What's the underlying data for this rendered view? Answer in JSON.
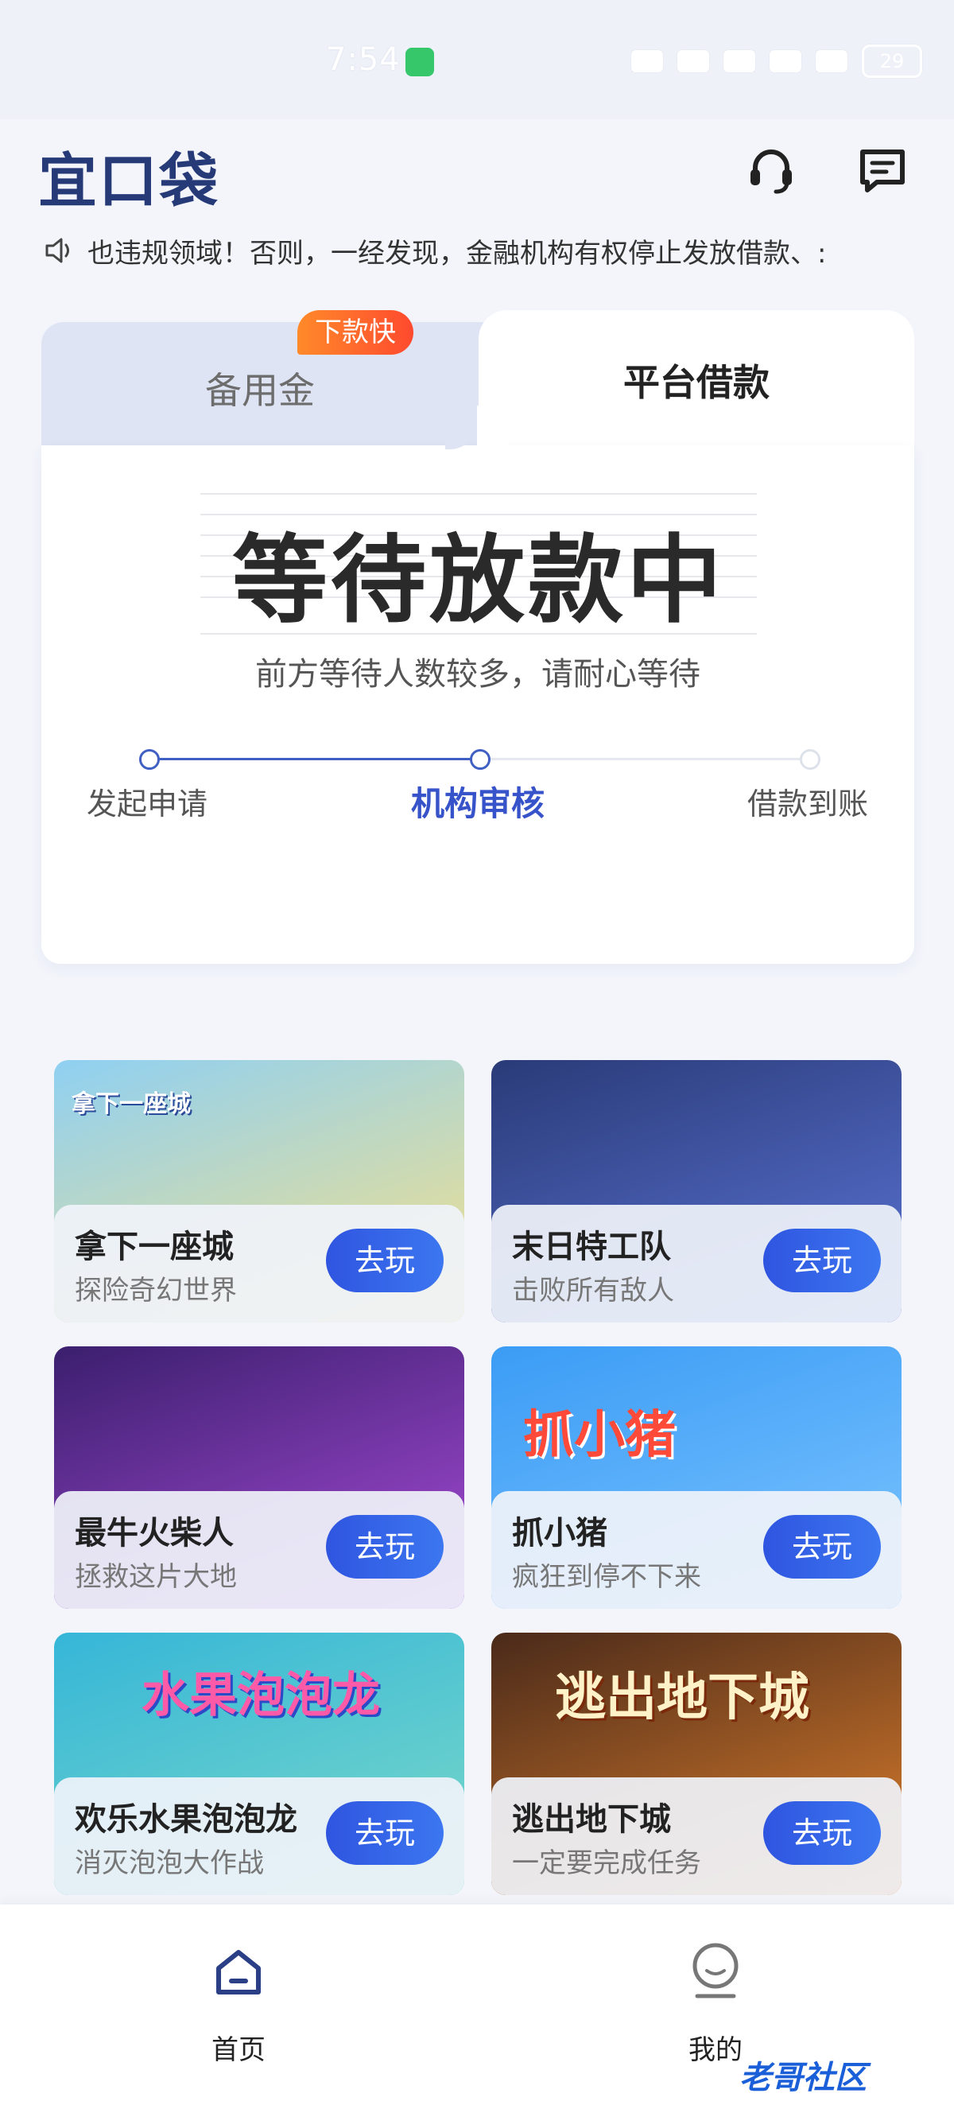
{
  "status_bar": {
    "time": "7:54",
    "battery": "29"
  },
  "header": {
    "logo": "宜口袋",
    "support_icon": "headset-icon",
    "message_icon": "message-icon"
  },
  "notice": {
    "icon": "speaker-icon",
    "text": "也违规领域！否则，一经发现，金融机构有权停止发放借款、:"
  },
  "loan_card": {
    "tabs": [
      {
        "label": "备用金",
        "badge": "下款快"
      },
      {
        "label": "平台借款"
      }
    ],
    "status_title": "等待放款中",
    "status_subtitle": "前方等待人数较多，请耐心等待",
    "steps": [
      {
        "label": "发起申请",
        "state": "done"
      },
      {
        "label": "机构审核",
        "state": "current"
      },
      {
        "label": "借款到账",
        "state": "todo"
      }
    ]
  },
  "games": [
    {
      "title": "拿下一座城",
      "subtitle": "探险奇幻世界",
      "button": "去玩",
      "art_text": "拿下一座城",
      "colors": [
        "#8fd0f2",
        "#f5e08a"
      ]
    },
    {
      "title": "末日特工队",
      "subtitle": "击败所有敌人",
      "button": "去玩",
      "art_text": "",
      "colors": [
        "#2a3b78",
        "#5b74d6"
      ]
    },
    {
      "title": "最牛火柴人",
      "subtitle": "拯救这片大地",
      "button": "去玩",
      "art_text": "",
      "colors": [
        "#3b1f6e",
        "#a84bd8"
      ]
    },
    {
      "title": "抓小猪",
      "subtitle": "疯狂到停不下来",
      "button": "去玩",
      "art_text": "抓小猪",
      "colors": [
        "#3b9cf5",
        "#7cc4ff"
      ]
    },
    {
      "title": "欢乐水果泡泡龙",
      "subtitle": "消灭泡泡大作战",
      "button": "去玩",
      "art_text": "水果泡泡龙",
      "colors": [
        "#36b6d8",
        "#7ad9c8"
      ]
    },
    {
      "title": "逃出地下城",
      "subtitle": "一定要完成任务",
      "button": "去玩",
      "art_text": "逃出地下城",
      "colors": [
        "#4a2a1a",
        "#e0802c"
      ]
    }
  ],
  "bottom_nav": [
    {
      "label": "首页",
      "icon": "home-icon",
      "active": true
    },
    {
      "label": "我的",
      "icon": "profile-icon",
      "active": false
    }
  ],
  "watermark": "老哥社区"
}
